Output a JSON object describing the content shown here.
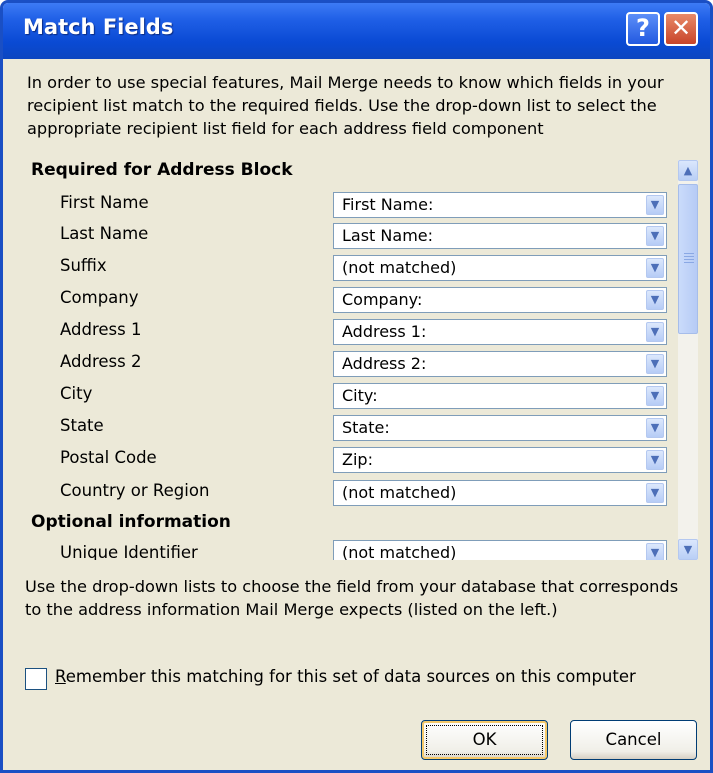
{
  "window": {
    "title": "Match Fields",
    "help_glyph": "?",
    "close_glyph": "✕"
  },
  "intro_text": "In order to use special features, Mail Merge needs to know which fields in your recipient list match to the required fields.  Use the drop-down list to select the appropriate recipient list field for each address field component",
  "required_section": {
    "heading": "Required for Address Block",
    "rows": [
      {
        "label": "First Name",
        "value": "First Name:"
      },
      {
        "label": "Last Name",
        "value": "Last Name:"
      },
      {
        "label": "Suffix",
        "value": "(not matched)"
      },
      {
        "label": "Company",
        "value": "Company:"
      },
      {
        "label": "Address 1",
        "value": "Address 1:"
      },
      {
        "label": "Address 2",
        "value": "Address 2:"
      },
      {
        "label": "City",
        "value": "City:"
      },
      {
        "label": "State",
        "value": "State:"
      },
      {
        "label": "Postal Code",
        "value": "Zip:"
      },
      {
        "label": "Country or Region",
        "value": "(not matched)"
      }
    ]
  },
  "optional_section": {
    "heading": "Optional information",
    "rows": [
      {
        "label": "Unique Identifier",
        "value": "(not matched)"
      }
    ]
  },
  "icons": {
    "dropdown_arrow": "chevron-down-icon",
    "scroll_up": "chevron-up-icon",
    "scroll_down": "chevron-down-icon"
  },
  "glyphs": {
    "down": "▼",
    "up": "▲"
  },
  "help_text": "Use the drop-down lists to choose the field from your database that corresponds to the address information Mail Merge expects (listed on the left.)",
  "remember_checkbox": {
    "label_first": "R",
    "label_rest": "emember this matching for this set of data sources on this computer",
    "checked": false
  },
  "buttons": {
    "ok": "OK",
    "cancel": "Cancel"
  },
  "colors": {
    "titlebar": "#0a4ad4",
    "dialog_bg": "#ece9d8",
    "close_button": "#c8442a"
  }
}
